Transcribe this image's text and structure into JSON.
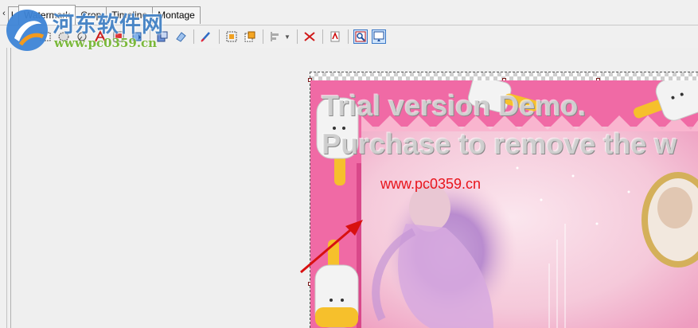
{
  "tabs": [
    {
      "label": "l",
      "active": false
    },
    {
      "label": "Watermark",
      "active": true
    },
    {
      "label": "Crop",
      "active": false
    },
    {
      "label": "Timeline",
      "active": false
    },
    {
      "label": "Montage",
      "active": false
    }
  ],
  "tab_scroll_label": "‹",
  "toolbar": {
    "buttons": [
      "rectangle-select-icon",
      "ellipse-select-icon",
      "lasso-icon",
      "text-tool-icon",
      "image-insert-icon",
      "drop-icon",
      "layer-icon",
      "eraser-icon",
      "brush-icon",
      "crop-select-icon",
      "copy-icon",
      "align-icon",
      "cut-icon",
      "pdf-icon",
      "zoom-fit-icon",
      "zoom-window-icon"
    ],
    "pressed": [
      "zoom-fit-icon",
      "zoom-window-icon"
    ]
  },
  "watermark_site": {
    "name": "河东软件网",
    "url": "www.pc0359.cn"
  },
  "canvas": {
    "demo_line_1": "Trial version Demo.",
    "demo_line_2": "Purchase to remove the w",
    "watermark_text": "www.pc0359.cn",
    "watermark_color": "#e8141c",
    "frame_color": "#f26aa6"
  }
}
